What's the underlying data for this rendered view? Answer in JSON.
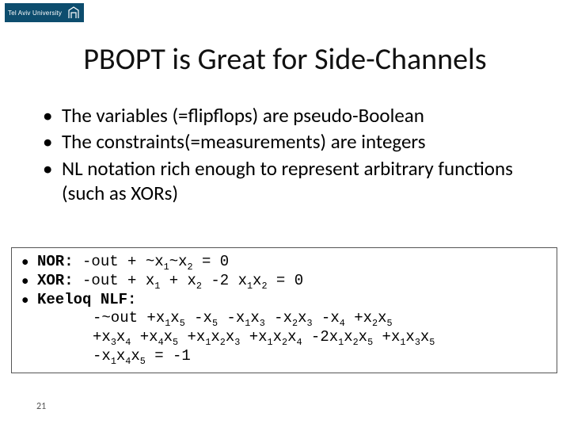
{
  "logo": {
    "text": "Tel Aviv University"
  },
  "title": "PBOPT is Great for Side-Channels",
  "bullets": [
    "The variables (=flipflops) are pseudo-Boolean",
    "The constraints(=measurements) are integers",
    "NL notation rich enough to represent arbitrary functions (such as XORs)"
  ],
  "code": {
    "nor": {
      "label": "NOR:",
      "expr_html": "-out + ~x<sub>1</sub>~x<sub>2</sub> = 0"
    },
    "xor": {
      "label": "XOR:",
      "expr_html": "-out + x<sub>1</sub> + x<sub>2</sub> -2 x<sub>1</sub>x<sub>2</sub> = 0"
    },
    "keeloq": {
      "label": "Keeloq NLF:",
      "line1_html": "-~out +x<sub>1</sub>x<sub>5</sub> -x<sub>5</sub> -x<sub>1</sub>x<sub>3</sub> -x<sub>2</sub>x<sub>3</sub> -x<sub>4</sub> +x<sub>2</sub>x<sub>5</sub>",
      "line2_html": "+x<sub>3</sub>x<sub>4</sub> +x<sub>4</sub>x<sub>5</sub> +x<sub>1</sub>x<sub>2</sub>x<sub>3</sub> +x<sub>1</sub>x<sub>2</sub>x<sub>4</sub> -2x<sub>1</sub>x<sub>2</sub>x<sub>5</sub> +x<sub>1</sub>x<sub>3</sub>x<sub>5</sub>",
      "line3_html": "-x<sub>1</sub>x<sub>4</sub>x<sub>5</sub> = -1"
    }
  },
  "page_number": "21"
}
